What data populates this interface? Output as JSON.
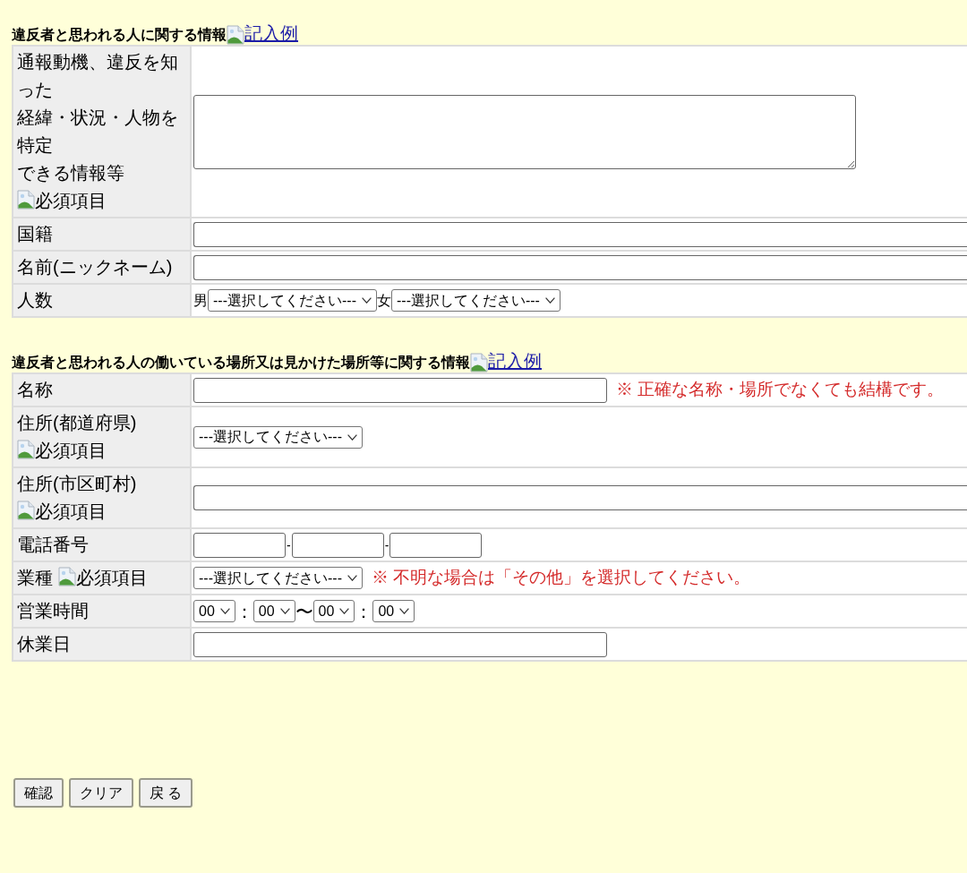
{
  "sections": [
    {
      "heading": "違反者と思われる人に関する情報",
      "example_link": "記入例",
      "rows": [
        {
          "kind": "textarea",
          "label": [
            "通報動機、違反を知った",
            "経緯・状況・人物を特定",
            "できる情報等"
          ],
          "required": "必須項目"
        },
        {
          "kind": "text",
          "label": [
            "国籍"
          ]
        },
        {
          "kind": "text",
          "label": [
            "名前(ニックネーム)"
          ]
        },
        {
          "kind": "counts",
          "label": [
            "人数"
          ],
          "selects": [
            {
              "prefix": "男",
              "value": "---選択してください---"
            },
            {
              "prefix": "女",
              "value": "---選択してください---"
            }
          ]
        }
      ]
    },
    {
      "heading": "違反者と思われる人の働いている場所又は見かけた場所等に関する情報",
      "example_link": "記入例",
      "rows": [
        {
          "kind": "short",
          "label": [
            "名称"
          ],
          "note": "※ 正確な名称・場所でなくても結構です。"
        },
        {
          "kind": "select",
          "label": [
            "住所(都道府県)"
          ],
          "required": "必須項目",
          "value": "---選択してください---"
        },
        {
          "kind": "text",
          "label": [
            "住所(市区町村)"
          ],
          "required": "必須項目"
        },
        {
          "kind": "phone",
          "label": [
            "電話番号"
          ],
          "separators": [
            "-",
            "-"
          ]
        },
        {
          "kind": "select",
          "label": [
            "業種"
          ],
          "required": "必須項目",
          "value": "---選択してください---",
          "note": "※ 不明な場合は「その他」を選択してください。"
        },
        {
          "kind": "hours",
          "label": [
            "営業時間"
          ],
          "values": [
            "00",
            "00",
            "00",
            "00"
          ],
          "separators": [
            "：",
            "〜",
            "："
          ]
        },
        {
          "kind": "short",
          "label": [
            "休業日"
          ]
        }
      ]
    }
  ],
  "buttons": [
    "確認",
    "クリア",
    "戻 る"
  ]
}
